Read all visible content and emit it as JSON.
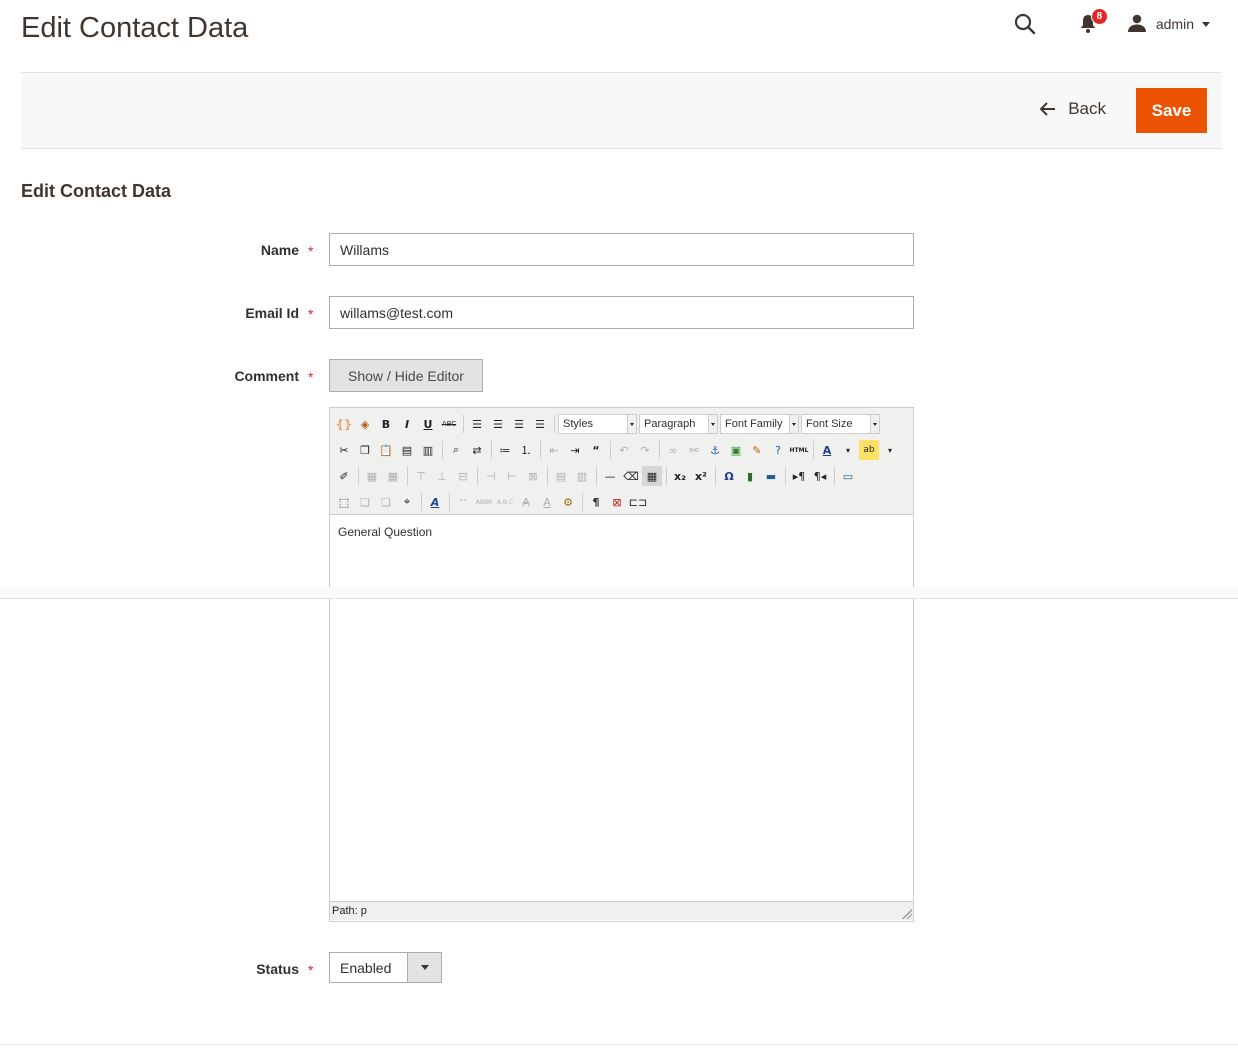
{
  "header": {
    "title": "Edit Contact Data",
    "notification_count": "8",
    "user_name": "admin"
  },
  "actions": {
    "back_label": "Back",
    "save_label": "Save"
  },
  "form": {
    "section_title": "Edit Contact Data",
    "required_mark": "*",
    "name": {
      "label": "Name",
      "value": "Willams"
    },
    "email": {
      "label": "Email Id",
      "value": "willams@test.com"
    },
    "comment": {
      "label": "Comment",
      "toggle_label": "Show / Hide Editor",
      "selects": {
        "styles": "Styles",
        "format": "Paragraph",
        "font_family": "Font Family",
        "font_size": "Font Size"
      },
      "content": "General Question",
      "path": "Path: p"
    },
    "status": {
      "label": "Status",
      "value": "Enabled"
    }
  },
  "colors": {
    "accent": "#eb5202",
    "required": "#e22626",
    "badge": "#e22626"
  }
}
